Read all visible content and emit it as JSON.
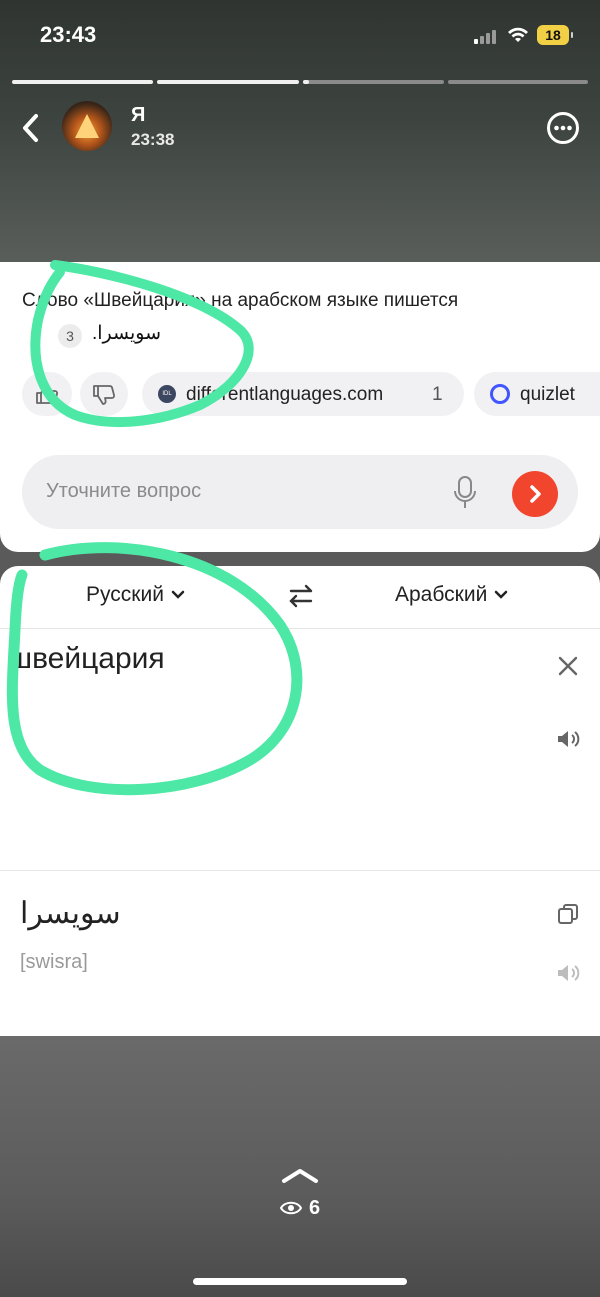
{
  "status_bar": {
    "time": "23:43",
    "battery": "18"
  },
  "story": {
    "progress": [
      1,
      1,
      0.05,
      0
    ],
    "user_name": "Я",
    "post_time": "23:38",
    "view_count": "6"
  },
  "answer": {
    "text": "Слово «Швейцария» на арабском языке пишется",
    "arabic": "سويسرا.",
    "citation_count": "3",
    "sources": [
      {
        "label": "differentlanguages.com",
        "count": "1",
        "icon_text": "IDL"
      },
      {
        "label": "quizlet"
      }
    ],
    "refine_placeholder": "Уточните вопрос"
  },
  "translator": {
    "source_lang": "Русский",
    "target_lang": "Арабский",
    "input_text": "швейцария",
    "result_text": "سويسرا",
    "transliteration": "[swisra]"
  },
  "colors": {
    "highlight": "#4ee8a6",
    "send_button": "#f2452d",
    "battery": "#f2d046"
  }
}
